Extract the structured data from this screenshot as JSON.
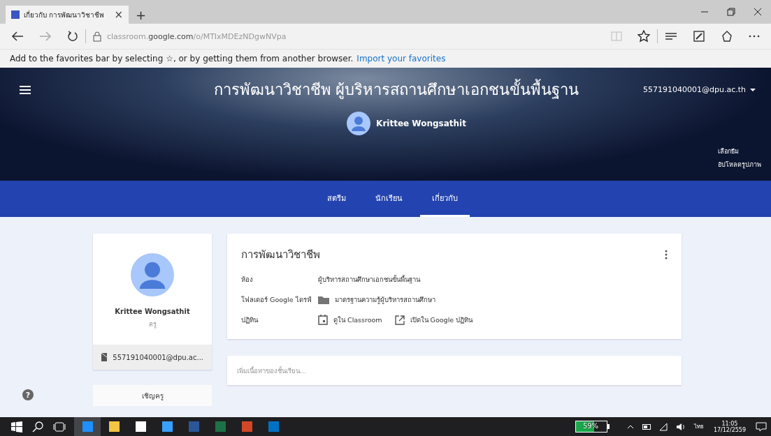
{
  "browser": {
    "tab": {
      "title": "เกี่ยวกับ การพัฒนาวิชาชีพ",
      "close": "×"
    },
    "new_tab": "+",
    "url": {
      "host": "classroom.",
      "domain": "google.com",
      "path": "/o/MTIxMDEzNDgwNVpa"
    },
    "favorites_bar": {
      "message": "Add to the favorites bar by selecting ☆, or by getting them from another browser.",
      "link": "Import your favorites"
    }
  },
  "header": {
    "title": "การพัฒนาวิชาชีพ ผู้บริหารสถานศึกษาเอกชนขั้นพื้นฐาน",
    "account": "557191040001@dpu.ac.th",
    "teacher": "Krittee Wongsathit",
    "theme_links": [
      "เลือกธีม",
      "อัปโหลดรูปภาพ"
    ]
  },
  "nav_tabs": [
    {
      "label": "สตรีม",
      "selected": false
    },
    {
      "label": "นักเรียน",
      "selected": false
    },
    {
      "label": "เกี่ยวกับ",
      "selected": true
    }
  ],
  "profile_card": {
    "name": "Krittee Wongsathit",
    "role": "ครู",
    "email": "557191040001@dpu.ac...",
    "invite": "เชิญครู"
  },
  "about_card": {
    "title": "การพัฒนาวิชาชีพ",
    "rows": [
      {
        "label": "ห้อง",
        "kind": "text",
        "value": "ผู้บริหารสถานศึกษาเอกชนขั้นพื้นฐาน"
      },
      {
        "label": "โฟลเดอร์ Google ไดรฟ์",
        "kind": "folder",
        "value": "มาตรฐานความรู้ผู้บริหารสถานศึกษา"
      },
      {
        "label": "ปฏิทิน",
        "kind": "calendar",
        "value": "ดูใน Classroom",
        "value2": "เปิดใน Google ปฏิทิน"
      }
    ]
  },
  "add_content": {
    "placeholder": "เพิ่มเนื้อหาของชั้นเรียน..."
  },
  "help": "?",
  "taskbar": {
    "apps": [
      {
        "kind": "edge",
        "selected": true
      },
      {
        "kind": "folder",
        "selected": false
      },
      {
        "kind": "store",
        "selected": false
      },
      {
        "kind": "ie",
        "selected": false
      },
      {
        "kind": "word",
        "selected": false
      },
      {
        "kind": "excel",
        "selected": false
      },
      {
        "kind": "powerpoint",
        "selected": false
      },
      {
        "kind": "outlook",
        "selected": false
      }
    ],
    "battery": {
      "level": 0.59,
      "reading": "59%"
    },
    "language": "ไทย",
    "time": "11:05",
    "date": "17/12/2559"
  }
}
